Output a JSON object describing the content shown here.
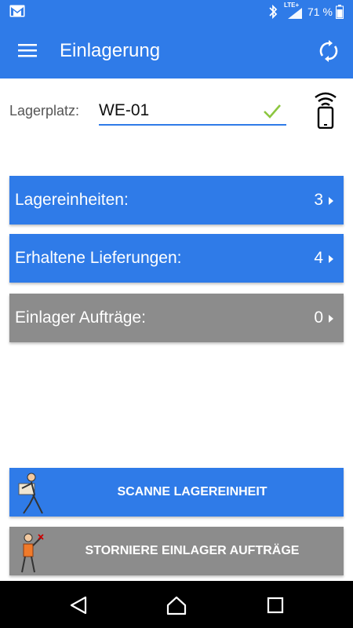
{
  "status_bar": {
    "network_label": "LTE+",
    "battery_text": "71 %"
  },
  "app_bar": {
    "title": "Einlagerung"
  },
  "location": {
    "label": "Lagerplatz:",
    "value": "WE-01"
  },
  "tiles": [
    {
      "label": "Lagereinheiten:",
      "count": "3"
    },
    {
      "label": "Erhaltene Lieferungen:",
      "count": "4"
    },
    {
      "label": "Einlager Aufträge:",
      "count": "0"
    }
  ],
  "actions": {
    "scan_label": "SCANNE LAGEREINHEIT",
    "cancel_label": "STORNIERE EINLAGER AUFTRÄGE"
  },
  "colors": {
    "primary": "#2f7be8",
    "disabled": "#8c8c8c",
    "check": "#8cc63f",
    "nav": "#000000"
  },
  "icons": [
    "gmail-icon",
    "bluetooth-icon",
    "signal-icon",
    "battery-icon",
    "menu-icon",
    "sync-icon",
    "check-icon",
    "rfid-scanner-icon",
    "chevron-right-icon",
    "back-icon",
    "home-icon",
    "recents-icon"
  ]
}
